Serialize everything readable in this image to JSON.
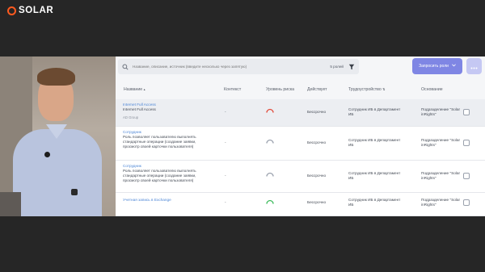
{
  "brand": {
    "name": "SOLAR",
    "accent": "#ff5a1f"
  },
  "search": {
    "placeholder": "Название, описание, источник (введите несколько через запятую)",
    "result_count": "5 ролей"
  },
  "actions": {
    "request_role_label": "Запросить роли"
  },
  "table": {
    "columns": {
      "name": "Название",
      "context": "Контекст",
      "risk": "Уровень риска",
      "validity": "Действует",
      "employment": "Трудоустройство",
      "basis": "Основание"
    },
    "rows": [
      {
        "title": "Internet Full Access",
        "subtitle": "Internet Full Access",
        "source": "AD Group",
        "context": "-",
        "risk_color": "#e24b3b",
        "validity": "Бессрочно",
        "employment": "Сотрудник ИБ в Департамент ИБ",
        "basis": "Подразделение \"Solar inRights\""
      },
      {
        "title": "Сотрудник",
        "description": "Роль позволяет пользователю выполнять стандартные операции (создание заявки, просмотр своей карточки пользователя)",
        "context": "-",
        "risk_color": "#9aa1ad",
        "validity": "Бессрочно",
        "employment": "Сотрудник ИБ в Департамент ИБ",
        "basis": "Подразделение \"Solar inRights\""
      },
      {
        "title": "Сотрудник",
        "description": "Роль позволяет пользователю выполнять стандартные операции (создание заявки, просмотр своей карточки пользователя)",
        "context": "-",
        "risk_color": "#9aa1ad",
        "validity": "Бессрочно",
        "employment": "Сотрудник ИБ в Департамент ИБ",
        "basis": "Подразделение \"Solar inRights\""
      },
      {
        "title": "Учетная запись в Exchange",
        "context": "-",
        "risk_color": "#3dbb5c",
        "validity": "Бессрочно",
        "employment": "Сотрудник ИБ в Департамент ИБ",
        "basis": "Подразделение \"Solar inRights\""
      }
    ]
  },
  "icons": [
    "search-icon",
    "filter-icon",
    "chevron-down-icon",
    "more-icon",
    "sort-icon",
    "risk-gauge-icon",
    "checkbox"
  ]
}
